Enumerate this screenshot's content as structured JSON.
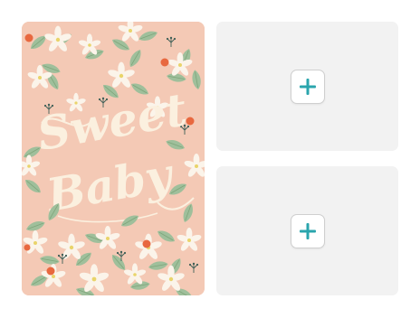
{
  "card": {
    "text_line1": "Sweet",
    "text_line2": "Baby",
    "background_color": "#f4c9b5",
    "leaf_color": "#9fbf9b",
    "flower_color": "#fbf4ea",
    "berry_color": "#e8683f"
  },
  "slots": [
    {
      "icon": "plus-icon",
      "accent": "#2aa5ad"
    },
    {
      "icon": "plus-icon",
      "accent": "#2aa5ad"
    }
  ]
}
